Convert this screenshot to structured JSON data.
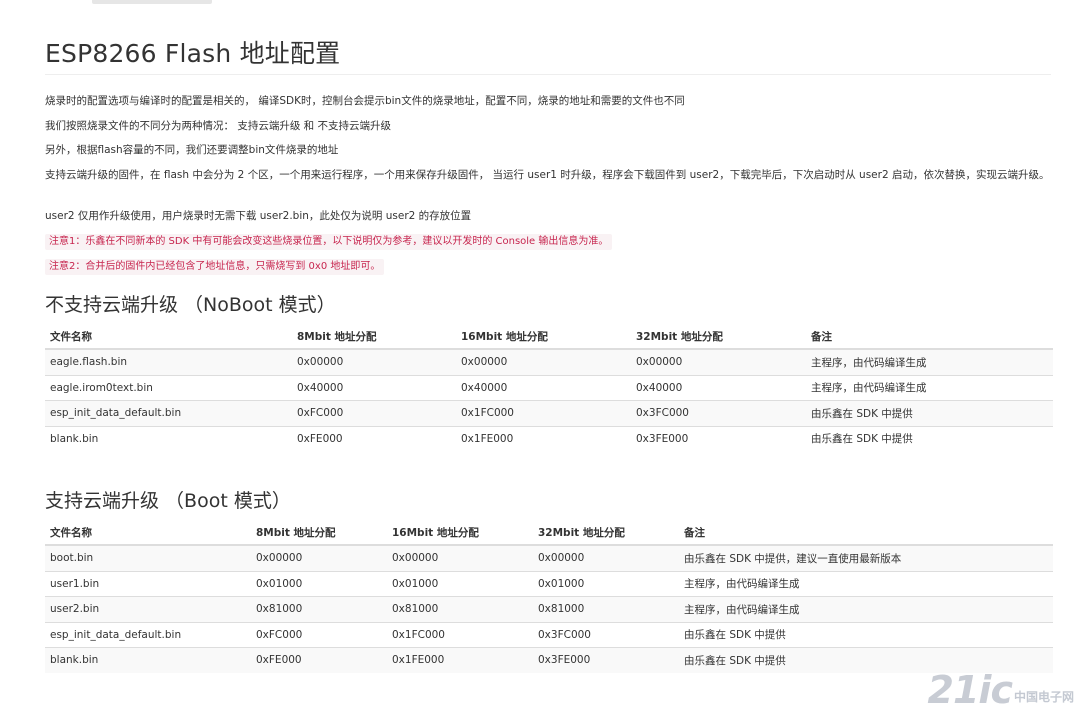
{
  "title": "ESP8266 Flash 地址配置",
  "paragraphs": [
    "烧录时的配置选项与编译时的配置是相关的， 编译SDK时，控制台会提示bin文件的烧录地址，配置不同，烧录的地址和需要的文件也不同",
    "我们按照烧录文件的不同分为两种情况： 支持云端升级 和 不支持云端升级",
    "另外，根据flash容量的不同，我们还要调整bin文件烧录的地址",
    "支持云端升级的固件，在 flash 中会分为 2 个区，一个用来运行程序，一个用来保存升级固件， 当运行 user1 时升级，程序会下载固件到 user2，下载完毕后，下次启动时从 user2 启动，依次替换，实现云端升级。",
    "user2 仅用作升级使用，用户烧录时无需下载 user2.bin，此处仅为说明 user2 的存放位置"
  ],
  "notes": [
    "注意1：乐鑫在不同新本的 SDK 中有可能会改变这些烧录位置，以下说明仅为参考，建议以开发时的 Console 输出信息为准。",
    "注意2：合并后的固件内已经包含了地址信息，只需烧写到 0x0 地址即可。"
  ],
  "sections": [
    {
      "title": "不支持云端升级 （NoBoot 模式）",
      "headers": [
        "文件名称",
        "8Mbit 地址分配",
        "16Mbit 地址分配",
        "32Mbit 地址分配",
        "备注"
      ],
      "rows": [
        [
          "eagle.flash.bin",
          "0x00000",
          "0x00000",
          "0x00000",
          "主程序，由代码编译生成"
        ],
        [
          "eagle.irom0text.bin",
          "0x40000",
          "0x40000",
          "0x40000",
          "主程序，由代码编译生成"
        ],
        [
          "esp_init_data_default.bin",
          "0xFC000",
          "0x1FC000",
          "0x3FC000",
          "由乐鑫在 SDK 中提供"
        ],
        [
          "blank.bin",
          "0xFE000",
          "0x1FE000",
          "0x3FE000",
          "由乐鑫在 SDK 中提供"
        ]
      ]
    },
    {
      "title": "支持云端升级 （Boot 模式）",
      "headers": [
        "文件名称",
        "8Mbit 地址分配",
        "16Mbit 地址分配",
        "32Mbit 地址分配",
        "备注"
      ],
      "rows": [
        [
          "boot.bin",
          "0x00000",
          "0x00000",
          "0x00000",
          "由乐鑫在 SDK 中提供，建议一直使用最新版本"
        ],
        [
          "user1.bin",
          "0x01000",
          "0x01000",
          "0x01000",
          "主程序，由代码编译生成"
        ],
        [
          "user2.bin",
          "0x81000",
          "0x81000",
          "0x81000",
          "主程序，由代码编译生成"
        ],
        [
          "esp_init_data_default.bin",
          "0xFC000",
          "0x1FC000",
          "0x3FC000",
          "由乐鑫在 SDK 中提供"
        ],
        [
          "blank.bin",
          "0xFE000",
          "0x1FE000",
          "0x3FE000",
          "由乐鑫在 SDK 中提供"
        ]
      ]
    }
  ],
  "watermark": {
    "main": "21ic",
    "sub": "中国电子网"
  }
}
